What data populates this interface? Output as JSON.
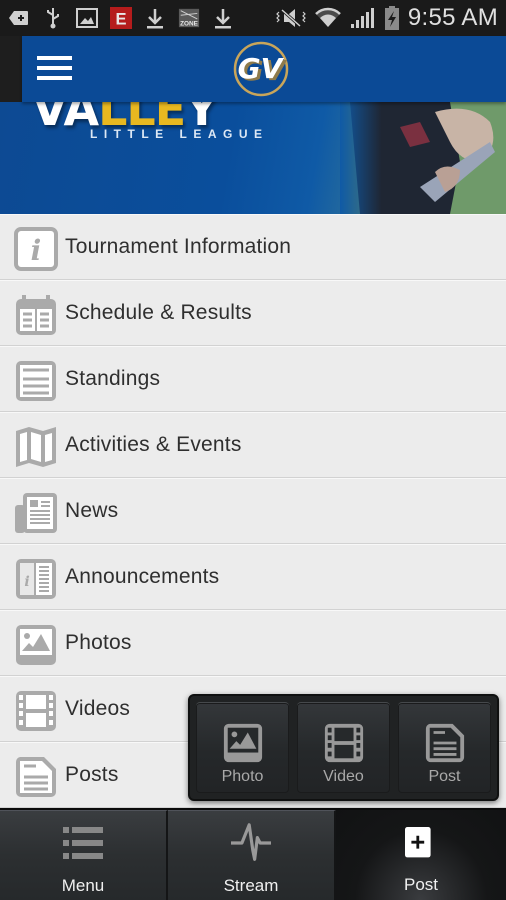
{
  "status_bar": {
    "notification_icons": [
      "add-icon",
      "usb-icon",
      "image-icon",
      "e-app-icon",
      "download-icon",
      "zone-app-icon",
      "download-icon"
    ],
    "system_icons": [
      "mute-vibrate-icon",
      "wifi-icon",
      "signal-icon",
      "battery-charging-icon"
    ],
    "time": "9:55 AM"
  },
  "header": {
    "logo_text": "GV",
    "menu_icon": "hamburger-icon"
  },
  "banner": {
    "title_white_1": "VA",
    "title_gold": "LLE",
    "title_white_2": "Y",
    "subtitle": "LITTLE LEAGUE"
  },
  "menu": {
    "items": [
      {
        "label": "Tournament Information",
        "icon": "info-icon"
      },
      {
        "label": "Schedule & Results",
        "icon": "calendar-icon"
      },
      {
        "label": "Standings",
        "icon": "standings-icon"
      },
      {
        "label": "Activities & Events",
        "icon": "map-icon"
      },
      {
        "label": "News",
        "icon": "newspaper-icon"
      },
      {
        "label": "Announcements",
        "icon": "announcement-icon"
      },
      {
        "label": "Photos",
        "icon": "photo-icon"
      },
      {
        "label": "Videos",
        "icon": "film-icon"
      },
      {
        "label": "Posts",
        "icon": "document-icon"
      }
    ]
  },
  "post_popup": {
    "buttons": [
      {
        "label": "Photo",
        "icon": "photo-icon"
      },
      {
        "label": "Video",
        "icon": "film-icon"
      },
      {
        "label": "Post",
        "icon": "document-icon"
      }
    ]
  },
  "tabbar": {
    "tabs": [
      {
        "label": "Menu",
        "icon": "list-icon",
        "active": false
      },
      {
        "label": "Stream",
        "icon": "pulse-icon",
        "active": false
      },
      {
        "label": "Post",
        "icon": "plus-icon",
        "active": true
      }
    ]
  },
  "colors": {
    "header_blue": "#0b4a96",
    "accent_gold": "#e8b820",
    "list_bg": "#ececec",
    "icon_gray": "#a8a8a8",
    "tabbar_dark": "#141516"
  }
}
